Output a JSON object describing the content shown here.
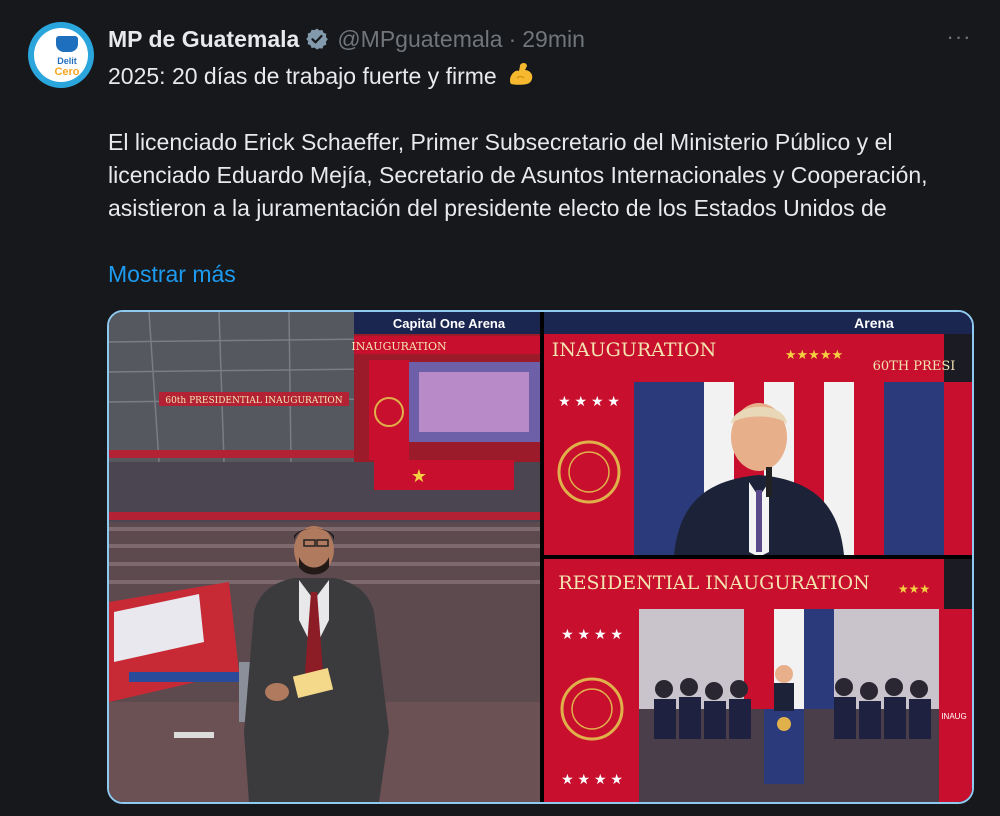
{
  "account": {
    "display_name": "MP de Guatemala",
    "handle": "@MPguatemala",
    "separator": "·",
    "timestamp": "29min",
    "avatar_text": "Delit",
    "avatar_text2": "Cero"
  },
  "menu_glyph": "···",
  "tweet": {
    "line1": "2025: 20 días de trabajo fuerte y firme",
    "emoji_icon": "flexed-biceps-icon",
    "body": "El licenciado Erick Schaeffer, Primer Subsecretario del Ministerio Público y el licenciado Eduardo Mejía, Secretario de Asuntos Internacionales y Cooperación, asistieron a la juramentación del presidente electo de los Estados Unidos de",
    "show_more": "Mostrar más"
  },
  "media": {
    "left_sign": "60th PRESIDENTIAL INAUGURATION",
    "left_sign_brand": "Capital One Arena",
    "left_banner": "INAUGURATION",
    "top_right_banner": "INAUGURATION",
    "top_right_tag": "60TH PRESI",
    "top_right_arena": "Arena",
    "bottom_right_banner": "RESIDENTIAL INAUGURATION",
    "inaug_small": "INAUG"
  },
  "colors": {
    "accent": "#1d9bf0",
    "verified": "#829aab",
    "muted": "#71767b",
    "banner_red": "#c8102e"
  }
}
